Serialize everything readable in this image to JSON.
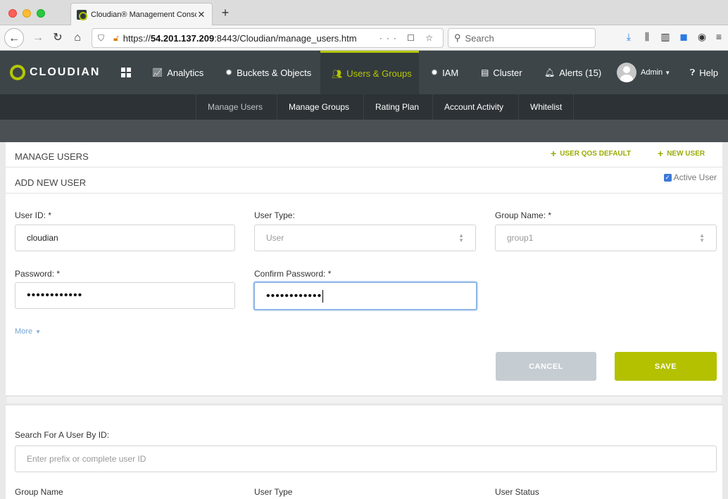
{
  "browser": {
    "tab_title": "Cloudian® Management Consol",
    "tab_close": "✕",
    "new_tab": "+",
    "url_prefix": "https://",
    "url_host": "54.201.137.209",
    "url_rest": ":8443/Cloudian/manage_users.htm",
    "url_actions": "··· ☐ ☆",
    "search_placeholder": "Search"
  },
  "app": {
    "logo_text": "CLOUDIAN",
    "accent_color": "#b5c700",
    "menu": [
      {
        "label": "Analytics",
        "icon": "chart-icon"
      },
      {
        "label": "Buckets & Objects",
        "icon": "gear-icon"
      },
      {
        "label": "Users & Groups",
        "icon": "users-icon",
        "active": true
      },
      {
        "label": "IAM",
        "icon": "gear-icon"
      },
      {
        "label": "Cluster",
        "icon": "server-icon"
      },
      {
        "label": "Alerts (15)",
        "icon": "bell-icon"
      },
      {
        "label": "Admin",
        "icon": "avatar"
      },
      {
        "label": "Help",
        "icon": "help-icon"
      }
    ],
    "submenu": [
      "Manage Users",
      "Manage Groups",
      "Rating Plan",
      "Account Activity",
      "Whitelist"
    ]
  },
  "page": {
    "title": "MANAGE USERS",
    "user_qos_default": "USER QOS DEFAULT",
    "new_user": "NEW USER",
    "section_title": "ADD NEW USER",
    "active_user_label": "Active User",
    "active_user_checked": true
  },
  "form": {
    "user_id_label": "User ID: *",
    "user_id_value": "cloudian",
    "user_type_label": "User Type:",
    "user_type_value": "User",
    "group_name_label": "Group Name: *",
    "group_name_value": "group1",
    "password_label": "Password: *",
    "password_value": "••••••••••••",
    "confirm_label": "Confirm Password: *",
    "confirm_value": "••••••••••••",
    "more_label": "More",
    "cancel_label": "CANCEL",
    "save_label": "SAVE"
  },
  "search": {
    "label": "Search For A User By ID:",
    "placeholder": "Enter prefix or complete user ID",
    "col_group": "Group Name",
    "col_type": "User Type",
    "col_status": "User Status"
  }
}
